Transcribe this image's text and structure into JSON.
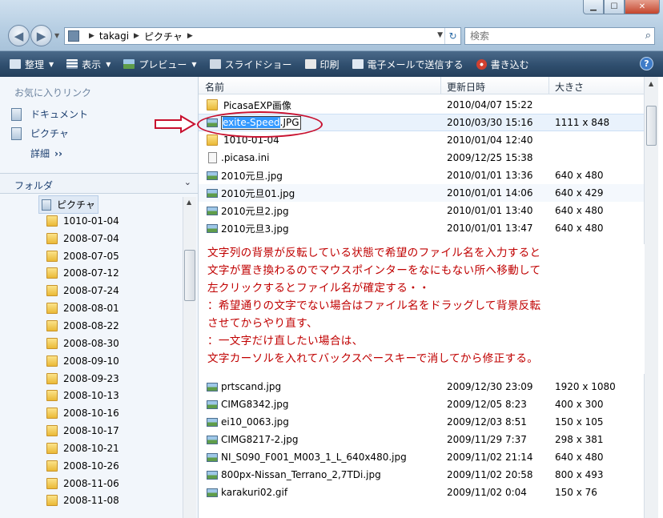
{
  "window": {
    "minimize": "▁",
    "maximize": "☐",
    "close": "✕"
  },
  "address": {
    "crumbs": [
      "takagi",
      "ピクチャ"
    ]
  },
  "search": {
    "placeholder": "検索"
  },
  "toolbar": {
    "items": [
      {
        "label": "整理",
        "icon": "organize-icon",
        "has_dropdown": true
      },
      {
        "label": "表示",
        "icon": "views-icon",
        "has_dropdown": true
      },
      {
        "label": "プレビュー",
        "icon": "preview-icon",
        "has_dropdown": true
      },
      {
        "label": "スライドショー",
        "icon": "slideshow-icon",
        "has_dropdown": false
      },
      {
        "label": "印刷",
        "icon": "print-icon",
        "has_dropdown": false
      },
      {
        "label": "電子メールで送信する",
        "icon": "email-icon",
        "has_dropdown": false
      },
      {
        "label": "書き込む",
        "icon": "burn-icon",
        "has_dropdown": false
      }
    ],
    "help": "?"
  },
  "navpane": {
    "favorites_title": "お気に入りリンク",
    "favorites": [
      "ドキュメント",
      "ピクチャ"
    ],
    "details": "詳細",
    "folders_title": "フォルダ",
    "tree_root": "ピクチャ",
    "tree": [
      "1010-01-04",
      "2008-07-04",
      "2008-07-05",
      "2008-07-12",
      "2008-07-24",
      "2008-08-01",
      "2008-08-22",
      "2008-08-30",
      "2008-09-10",
      "2008-09-23",
      "2008-10-13",
      "2008-10-16",
      "2008-10-17",
      "2008-10-21",
      "2008-10-26",
      "2008-11-06",
      "2008-11-08"
    ]
  },
  "filelist": {
    "columns": {
      "name": "名前",
      "date": "更新日時",
      "size": "大きさ"
    },
    "rename": {
      "selected": "exite-Speed",
      "rest": ".JPG"
    },
    "rows_top": [
      {
        "name": "PicasaEXP画像",
        "date": "2010/04/07 15:22",
        "size": "",
        "type": "folder"
      },
      {
        "name": "exite-Speed.JPG",
        "date": "2010/03/30 15:16",
        "size": "1111 x 848",
        "type": "image",
        "renaming": true
      },
      {
        "name": "1010-01-04",
        "date": "2010/01/04 12:40",
        "size": "",
        "type": "folder"
      },
      {
        "name": ".picasa.ini",
        "date": "2009/12/25 15:38",
        "size": "",
        "type": "file"
      },
      {
        "name": "2010元旦.jpg",
        "date": "2010/01/01 13:36",
        "size": "640 x 480",
        "type": "image"
      },
      {
        "name": "2010元旦01.jpg",
        "date": "2010/01/01 14:06",
        "size": "640 x 429",
        "type": "image"
      },
      {
        "name": "2010元旦2.jpg",
        "date": "2010/01/01 13:40",
        "size": "640 x 480",
        "type": "image"
      },
      {
        "name": "2010元旦3.jpg",
        "date": "2010/01/01 13:47",
        "size": "640 x 480",
        "type": "image"
      }
    ],
    "rows_bottom": [
      {
        "name": "prtscand.jpg",
        "date": "2009/12/30 23:09",
        "size": "1920 x 1080",
        "type": "image"
      },
      {
        "name": "CIMG8342.jpg",
        "date": "2009/12/05 8:23",
        "size": "400 x 300",
        "type": "image"
      },
      {
        "name": "ei10_0063.jpg",
        "date": "2009/12/03 8:51",
        "size": "150 x 105",
        "type": "image"
      },
      {
        "name": "CIMG8217-2.jpg",
        "date": "2009/11/29 7:37",
        "size": "298 x 381",
        "type": "image"
      },
      {
        "name": "NI_S090_F001_M003_1_L_640x480.jpg",
        "date": "2009/11/02 21:14",
        "size": "640 x 480",
        "type": "image"
      },
      {
        "name": "800px-Nissan_Terrano_2,7TDi.jpg",
        "date": "2009/11/02 20:58",
        "size": "800 x 493",
        "type": "image"
      },
      {
        "name": "karakuri02.gif",
        "date": "2009/11/02 0:04",
        "size": "150 x 76",
        "type": "image"
      }
    ]
  },
  "annotation": {
    "color": "#c00000",
    "lines": [
      "文字列の背景が反転している状態で希望のファイル名を入力すると",
      "文字が置き換わるのでマウスポインターをなにもない所へ移動して",
      "左クリックするとファイル名が確定する・・",
      "：希望通りの文字でない場合はファイル名をドラッグして背景反転",
      "させてからやり直す、",
      "：一文字だけ直したい場合は、",
      "文字カーソルを入れてバックスペースキーで消してから修正する。"
    ]
  }
}
